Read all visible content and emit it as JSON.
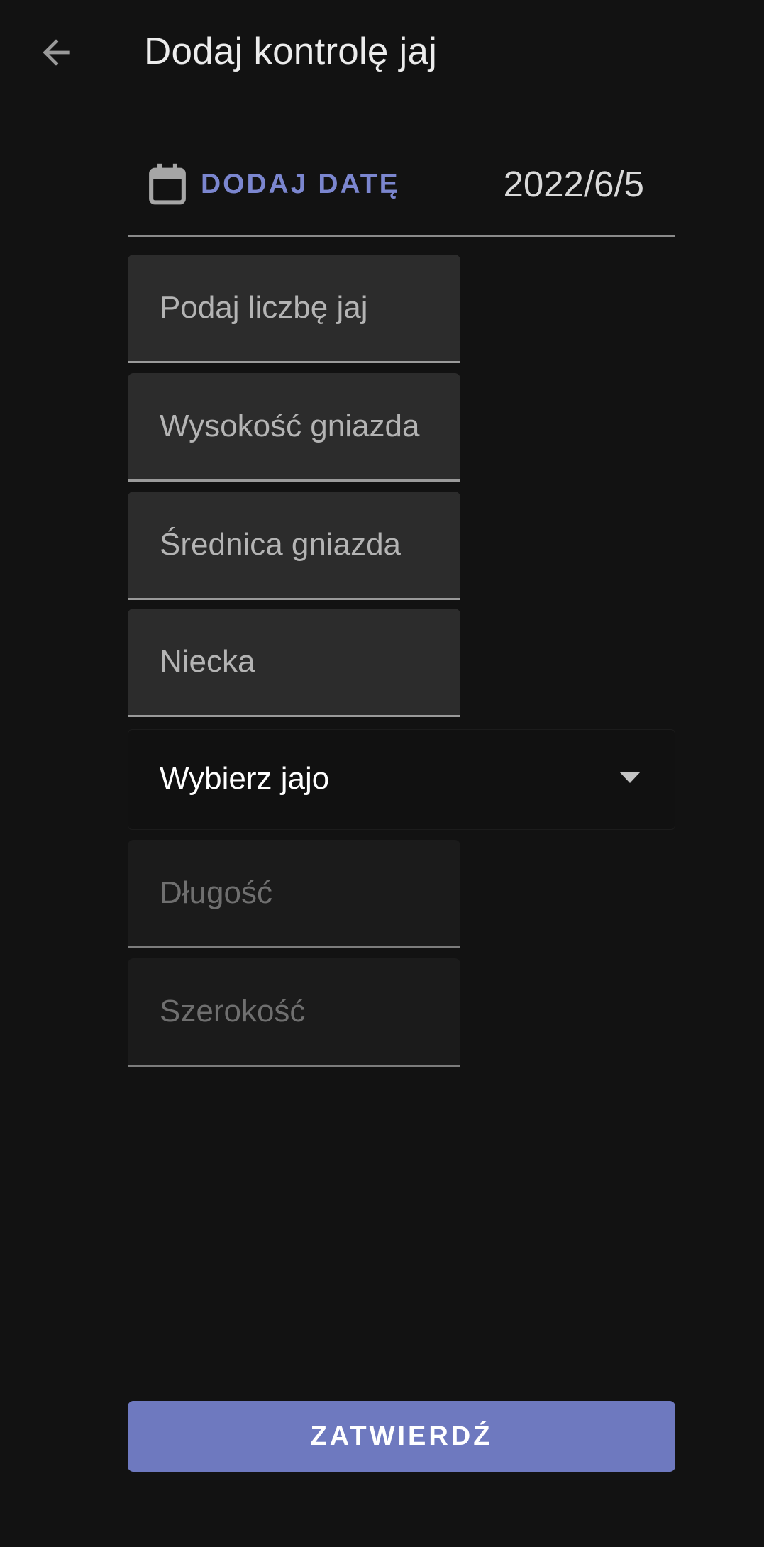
{
  "header": {
    "title": "Dodaj kontrolę jaj",
    "back_icon": "arrow-back-icon"
  },
  "date": {
    "button_label": "DODAJ DATĘ",
    "icon": "calendar-icon",
    "value": "2022/6/5",
    "accent_color": "#7b86cf"
  },
  "fields": {
    "egg_count_placeholder": "Podaj liczbę jaj",
    "nest_height_placeholder": "Wysokość gniazda",
    "nest_diameter_placeholder": "Średnica gniazda",
    "nest_cup_placeholder": "Niecka",
    "length_placeholder": "Długość",
    "width_placeholder": "Szerokość"
  },
  "egg_select": {
    "value": "Wybierz jajo",
    "icon": "dropdown-arrow-icon"
  },
  "submit": {
    "label": "ZATWIERDŹ",
    "color": "#6e79bf"
  }
}
